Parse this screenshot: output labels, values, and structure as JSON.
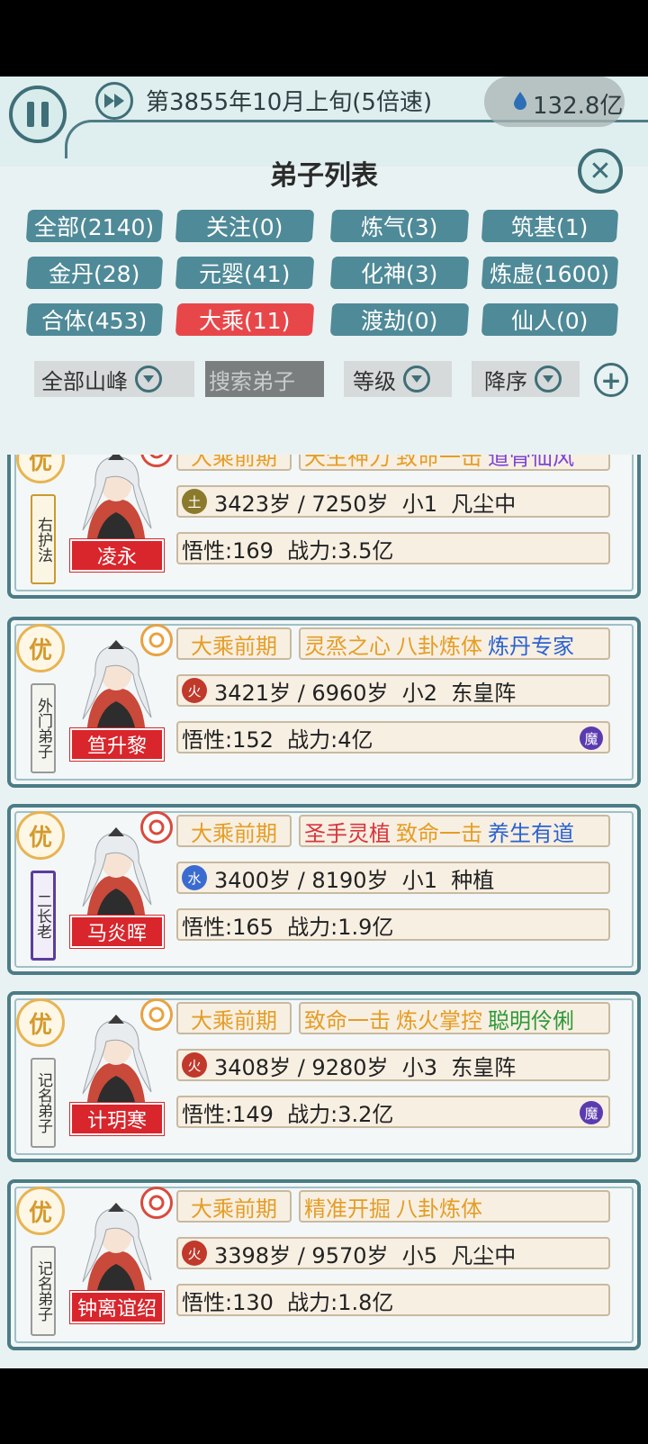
{
  "header": {
    "date": "第3855年10月上旬(5倍速)",
    "money": "132.8亿"
  },
  "dialog": {
    "title": "弟子列表"
  },
  "filters": [
    {
      "label": "全部(2140)",
      "active": false
    },
    {
      "label": "关注(0)",
      "active": false
    },
    {
      "label": "炼气(3)",
      "active": false
    },
    {
      "label": "筑基(1)",
      "active": false
    },
    {
      "label": "金丹(28)",
      "active": false
    },
    {
      "label": "元婴(41)",
      "active": false
    },
    {
      "label": "化神(3)",
      "active": false
    },
    {
      "label": "炼虚(1600)",
      "active": false
    },
    {
      "label": "合体(453)",
      "active": false
    },
    {
      "label": "大乘(11)",
      "active": true
    },
    {
      "label": "渡劫(0)",
      "active": false
    },
    {
      "label": "仙人(0)",
      "active": false
    }
  ],
  "controls": {
    "mountain": "全部山峰",
    "search_placeholder": "搜索弟子",
    "sort_field": "等级",
    "sort_order": "降序"
  },
  "disciples": [
    {
      "badge": "优",
      "role": "右护法",
      "name": "凌永",
      "realm": "大乘前期",
      "traits": [
        {
          "text": "天生神力",
          "color": "orange"
        },
        {
          "text": "致命一击",
          "color": "orange"
        },
        {
          "text": "道骨仙风",
          "color": "purple"
        }
      ],
      "element": "土",
      "life": "3423岁 / 7250岁  小1  凡尘中",
      "stats": "悟性:169  战力:3.5亿",
      "mo": ""
    },
    {
      "badge": "优",
      "role": "外门弟子",
      "name": "笪升黎",
      "realm": "大乘前期",
      "traits": [
        {
          "text": "灵烝之心",
          "color": "orange"
        },
        {
          "text": "八卦炼体",
          "color": "orange"
        },
        {
          "text": "炼丹专家",
          "color": "blue"
        }
      ],
      "element": "火",
      "life": "3421岁 / 6960岁  小2  东皇阵",
      "stats": "悟性:152  战力:4亿",
      "mo": "魔"
    },
    {
      "badge": "优",
      "role": "二长老",
      "name": "马炎晖",
      "realm": "大乘前期",
      "traits": [
        {
          "text": "圣手灵植",
          "color": "red"
        },
        {
          "text": "致命一击",
          "color": "orange"
        },
        {
          "text": "养生有道",
          "color": "blue"
        }
      ],
      "element": "水",
      "life": "3400岁 / 8190岁  小1  种植",
      "stats": "悟性:165  战力:1.9亿",
      "mo": ""
    },
    {
      "badge": "优",
      "role": "记名弟子",
      "name": "计玥寒",
      "realm": "大乘前期",
      "traits": [
        {
          "text": "致命一击",
          "color": "orange"
        },
        {
          "text": "炼火掌控",
          "color": "orange"
        },
        {
          "text": "聪明伶俐",
          "color": "green"
        }
      ],
      "element": "火",
      "life": "3408岁 / 9280岁  小3  东皇阵",
      "stats": "悟性:149  战力:3.2亿",
      "mo": "魔"
    },
    {
      "badge": "优",
      "role": "记名弟子",
      "name": "钟离谊绍",
      "realm": "大乘前期",
      "traits": [
        {
          "text": "精准开掘",
          "color": "orange"
        },
        {
          "text": "八卦炼体",
          "color": "orange"
        }
      ],
      "element": "火",
      "life": "3398岁 / 9570岁  小5  凡尘中",
      "stats": "悟性:130  战力:1.8亿",
      "mo": ""
    }
  ],
  "colors": {
    "accent": "#4f8a98",
    "active_filter": "#e8474a",
    "name_tag": "#d8262c",
    "realm_text": "#e59d25"
  }
}
